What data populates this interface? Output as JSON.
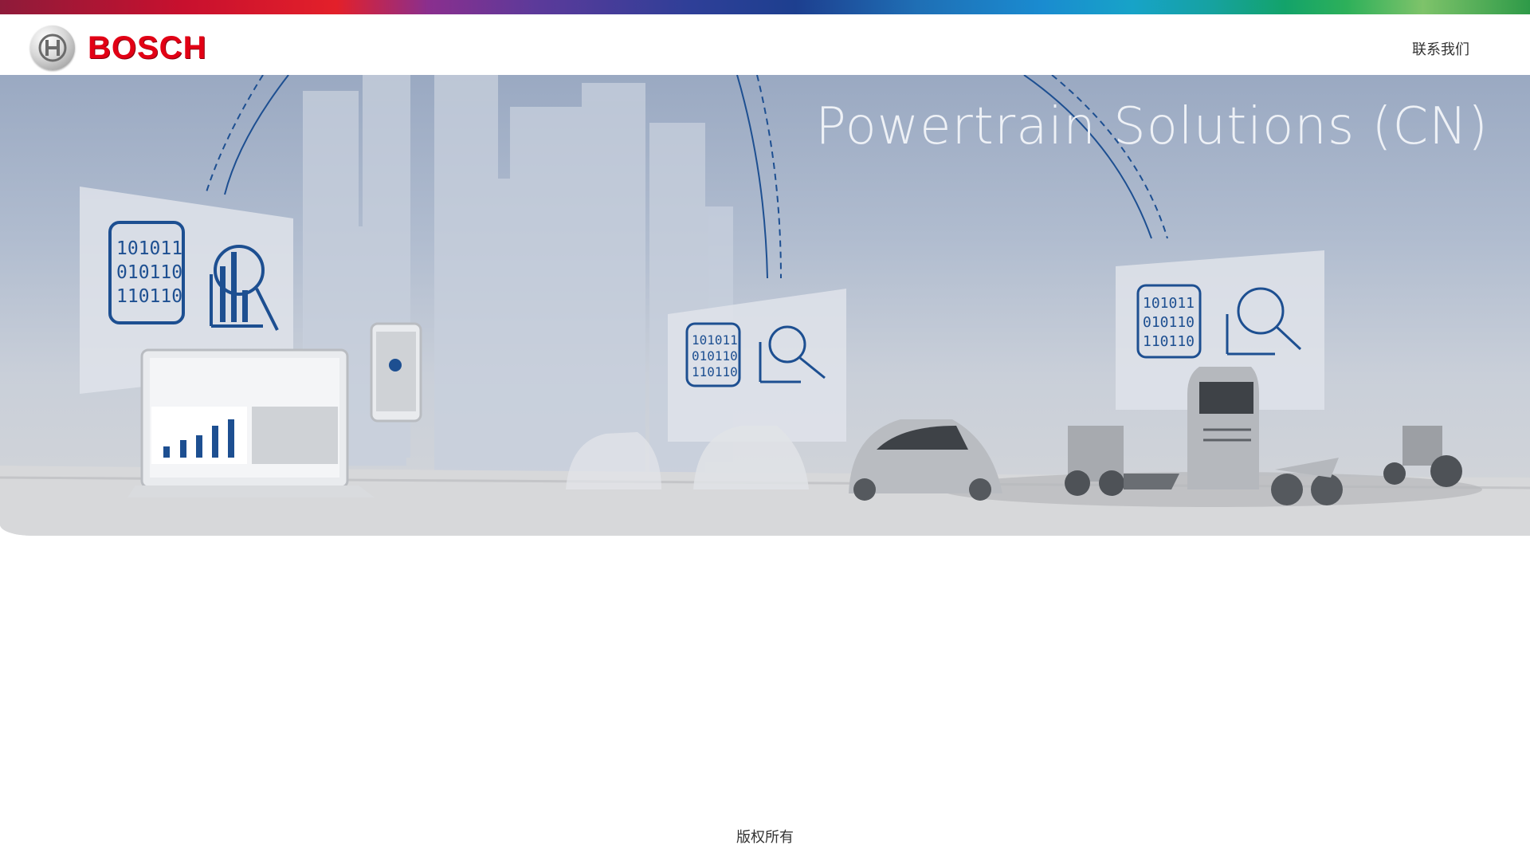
{
  "header": {
    "brand": "BOSCH",
    "logo_icon": "bosch-armature-icon",
    "contact_label": "联系我们"
  },
  "hero": {
    "title": "Powertrain Solutions (CN)",
    "panel_code_lines": [
      "101011",
      "010110",
      "110110"
    ]
  },
  "footer": {
    "copyright": "版权所有"
  },
  "colors": {
    "brand_red": "#e20015",
    "accent_blue": "#1d4f91",
    "hero_bg": "#b0bccf"
  }
}
